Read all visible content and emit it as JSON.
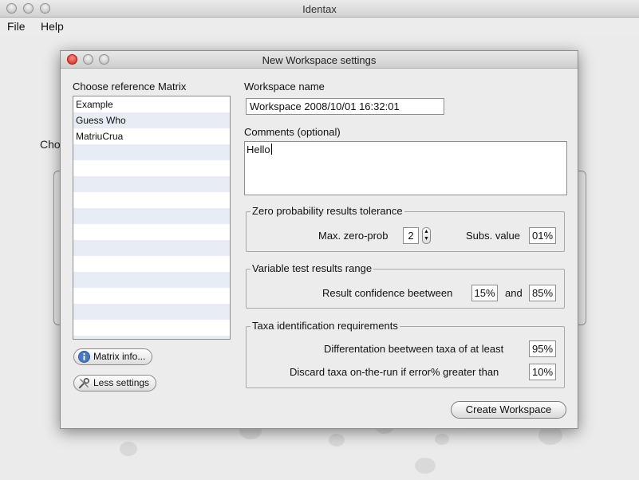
{
  "app": {
    "title": "Identax",
    "menu": [
      "File",
      "Help"
    ],
    "background_label": "Cho"
  },
  "dialog": {
    "title": "New Workspace settings",
    "matrix": {
      "label": "Choose reference Matrix",
      "items": [
        "Example",
        "Guess Who",
        "MatriuCrua"
      ],
      "info_button": "Matrix info...",
      "less_button": "Less settings"
    },
    "workspace": {
      "label": "Workspace name",
      "value": "Workspace 2008/10/01 16:32:01"
    },
    "comments": {
      "label": "Comments (optional)",
      "value": "Hello"
    },
    "zero_prob": {
      "title": "Zero probability results tolerance",
      "max_label": "Max. zero-prob",
      "max_value": "2",
      "subs_label": "Subs. value",
      "subs_value": "01%"
    },
    "variable": {
      "title": "Variable test results range",
      "label": "Result confidence beetween",
      "low": "15%",
      "and_label": "and",
      "high": "85%"
    },
    "taxa": {
      "title": "Taxa identification requirements",
      "diff_label": "Differentation beetween taxa of at least",
      "diff_value": "95%",
      "discard_label": "Discard taxa on-the-run if error% greater than",
      "discard_value": "10%"
    },
    "create_button": "Create Workspace"
  },
  "colors": {
    "close_red": "#d0211a",
    "list_alt_row": "#e7ecf5",
    "info_blue": "#4a78c2"
  },
  "icons": [
    "info-icon",
    "tools-icon",
    "stepper-up-icon",
    "stepper-down-icon"
  ]
}
